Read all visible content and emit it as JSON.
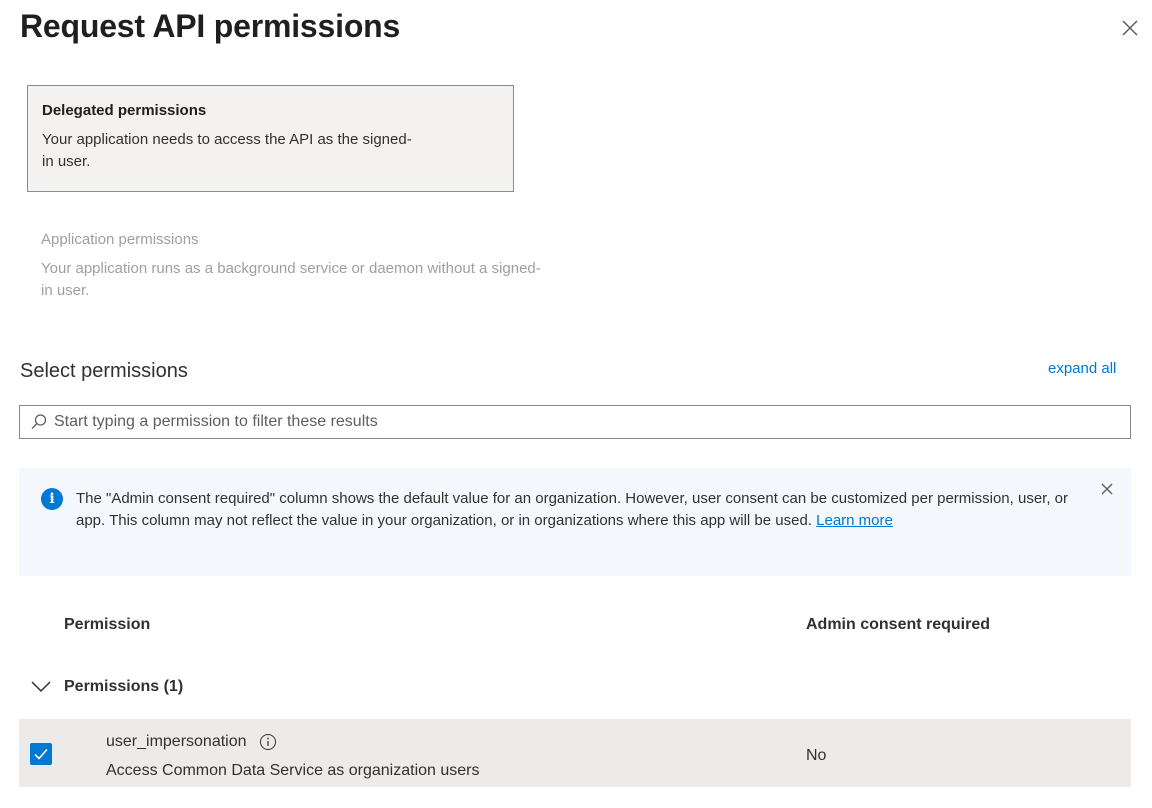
{
  "panel": {
    "title": "Request API permissions",
    "close_icon": "close-icon"
  },
  "permission_types": [
    {
      "title": "Delegated permissions",
      "description": "Your application needs to access the API as the signed-in user.",
      "selected": true
    },
    {
      "title": "Application permissions",
      "description": "Your application runs as a background service or daemon without a signed-in user.",
      "selected": false
    }
  ],
  "select_permissions": {
    "title": "Select permissions",
    "expand_all": "expand all",
    "search": {
      "placeholder": "Start typing a permission to filter these results",
      "value": ""
    }
  },
  "info_bar": {
    "text": "The \"Admin consent required\" column shows the default value for an organization. However, user consent can be customized per permission, user, or app. This column may not reflect the value in your organization, or in organizations where this app will be used. ",
    "link": "Learn more",
    "icon": "info-icon",
    "color": "#0078d4"
  },
  "table": {
    "headers": [
      "Permission",
      "Admin consent required"
    ],
    "group": {
      "label": "Permissions (1)",
      "expanded": true
    },
    "rows": [
      {
        "name": "user_impersonation",
        "description": "Access Common Data Service as organization users",
        "admin_consent": "No",
        "checked": true
      }
    ]
  },
  "colors": {
    "accent": "#0078d4",
    "selected_card_border": "#6a91c7",
    "row_background": "#edebe9"
  }
}
